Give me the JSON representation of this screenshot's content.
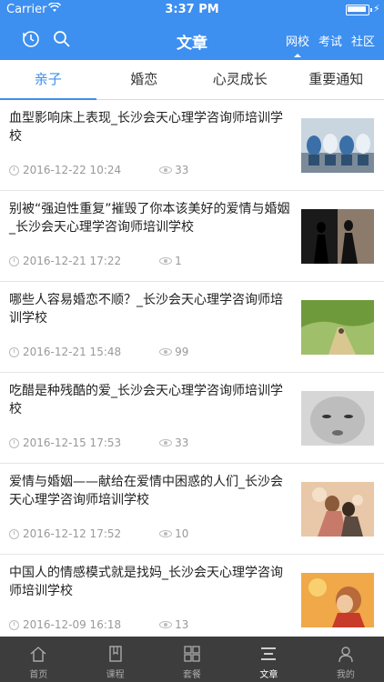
{
  "status_bar": {
    "carrier": "Carrier",
    "wifi": "wifi-icon",
    "time": "3:37 PM"
  },
  "nav": {
    "title": "文章",
    "links": [
      {
        "label": "网校",
        "active": true
      },
      {
        "label": "考试",
        "active": false
      },
      {
        "label": "社区",
        "active": false
      }
    ]
  },
  "tabs": [
    {
      "label": "亲子",
      "active": true
    },
    {
      "label": "婚恋",
      "active": false
    },
    {
      "label": "心灵成长",
      "active": false
    },
    {
      "label": "重要通知",
      "active": false
    }
  ],
  "articles": [
    {
      "title": "血型影响床上表现_长沙会天心理学咨询师培训学校",
      "date": "2016-12-22 10:24",
      "views": "33",
      "thumb": "dolls"
    },
    {
      "title": "别被“强迫性重复”摧毁了你本该美好的爱情与婚姻_长沙会天心理学咨询师培训学校",
      "date": "2016-12-21 17:22",
      "views": "1",
      "thumb": "silhouette"
    },
    {
      "title": "哪些人容易婚恋不顺？_长沙会天心理学咨询师培训学校",
      "date": "2016-12-21 15:48",
      "views": "99",
      "thumb": "path"
    },
    {
      "title": "吃醋是种残酷的爱_长沙会天心理学咨询师培训学校",
      "date": "2016-12-15 17:53",
      "views": "33",
      "thumb": "baby"
    },
    {
      "title": "爱情与婚姻——献给在爱情中困惑的人们_长沙会天心理学咨询师培训学校",
      "date": "2016-12-12 17:52",
      "views": "10",
      "thumb": "couple"
    },
    {
      "title": "中国人的情感模式就是找妈_长沙会天心理学咨询师培训学校",
      "date": "2016-12-09 16:18",
      "views": "13",
      "thumb": "child"
    }
  ],
  "tabbar": [
    {
      "label": "首页",
      "icon": "home-icon",
      "active": false
    },
    {
      "label": "课程",
      "icon": "book-icon",
      "active": false
    },
    {
      "label": "套餐",
      "icon": "grid-icon",
      "active": false
    },
    {
      "label": "文章",
      "icon": "list-icon",
      "active": true
    },
    {
      "label": "我的",
      "icon": "user-icon",
      "active": false
    }
  ],
  "colors": {
    "primary": "#3d8ff0",
    "tabbar": "#3d3d3d"
  }
}
